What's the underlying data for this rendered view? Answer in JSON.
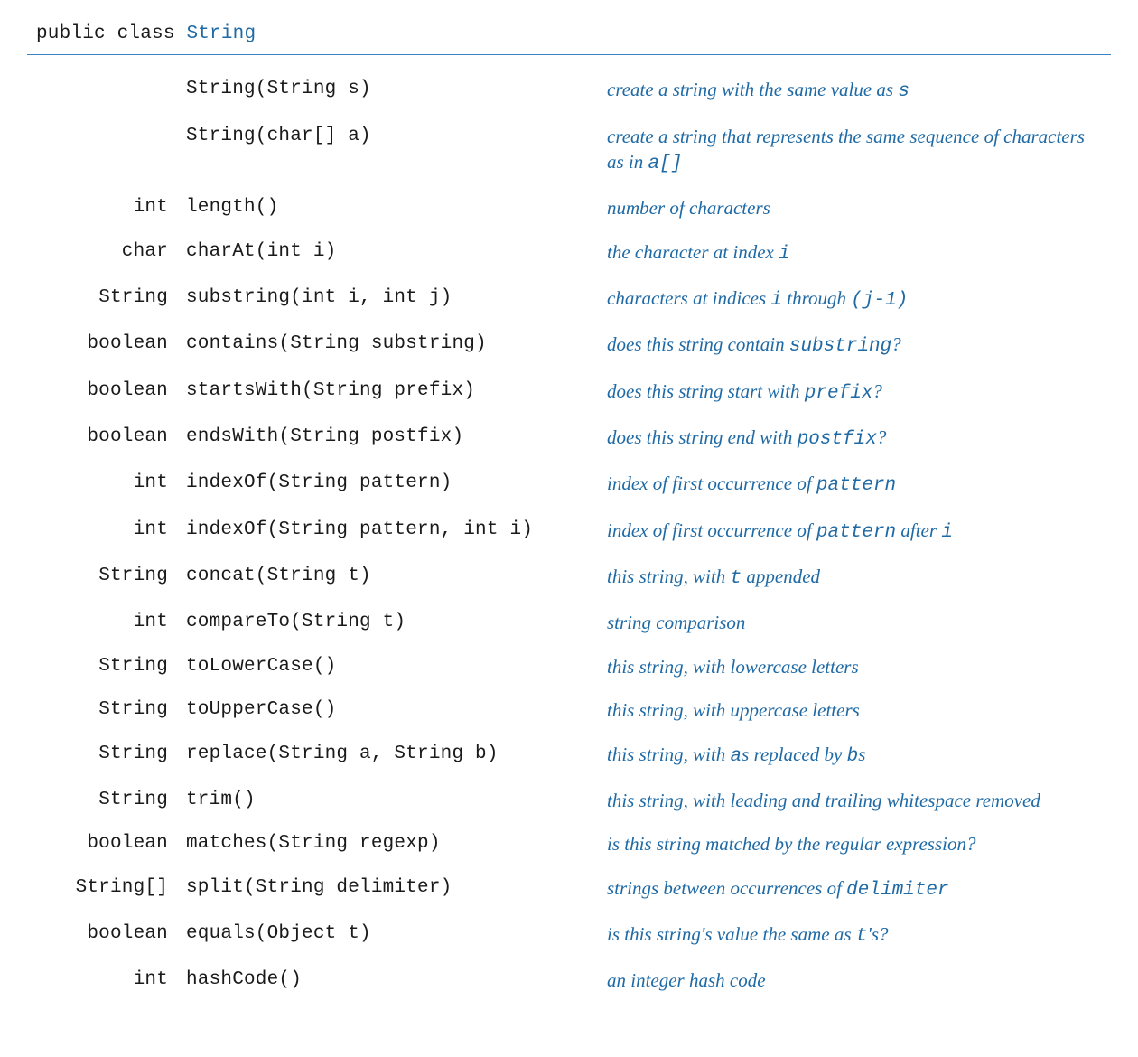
{
  "header": {
    "prefix": "public class ",
    "class_name": "String"
  },
  "rows": [
    {
      "return_type": "",
      "signature": "String(String s)",
      "desc_parts": [
        {
          "t": "text",
          "v": "create a string with the same value as "
        },
        {
          "t": "code",
          "v": "s"
        }
      ]
    },
    {
      "return_type": "",
      "signature": "String(char[] a)",
      "desc_parts": [
        {
          "t": "text",
          "v": "create a string that represents the same sequence of characters as in "
        },
        {
          "t": "code",
          "v": "a[]"
        }
      ]
    },
    {
      "return_type": "int",
      "signature": "length()",
      "desc_parts": [
        {
          "t": "text",
          "v": "number of characters"
        }
      ]
    },
    {
      "return_type": "char",
      "signature": "charAt(int i)",
      "desc_parts": [
        {
          "t": "text",
          "v": "the character at index "
        },
        {
          "t": "code",
          "v": "i"
        }
      ]
    },
    {
      "return_type": "String",
      "signature": "substring(int i, int j)",
      "desc_parts": [
        {
          "t": "text",
          "v": "characters at indices "
        },
        {
          "t": "code",
          "v": "i"
        },
        {
          "t": "text",
          "v": " through "
        },
        {
          "t": "code",
          "v": "(j-1)"
        }
      ]
    },
    {
      "return_type": "boolean",
      "signature": "contains(String substring)",
      "desc_parts": [
        {
          "t": "text",
          "v": "does this string contain "
        },
        {
          "t": "code",
          "v": "substring"
        },
        {
          "t": "text",
          "v": "?"
        }
      ]
    },
    {
      "return_type": "boolean",
      "signature": "startsWith(String prefix)",
      "desc_parts": [
        {
          "t": "text",
          "v": "does this string start with "
        },
        {
          "t": "code",
          "v": "prefix"
        },
        {
          "t": "text",
          "v": "?"
        }
      ]
    },
    {
      "return_type": "boolean",
      "signature": "endsWith(String postfix)",
      "desc_parts": [
        {
          "t": "text",
          "v": "does this string end with "
        },
        {
          "t": "code",
          "v": "postfix"
        },
        {
          "t": "text",
          "v": "?"
        }
      ]
    },
    {
      "return_type": "int",
      "signature": "indexOf(String pattern)",
      "desc_parts": [
        {
          "t": "text",
          "v": "index of first occurrence of "
        },
        {
          "t": "code",
          "v": "pattern"
        }
      ]
    },
    {
      "return_type": "int",
      "signature": "indexOf(String pattern, int i)",
      "desc_parts": [
        {
          "t": "text",
          "v": "index of first occurrence of "
        },
        {
          "t": "code",
          "v": "pattern"
        },
        {
          "t": "text",
          "v": " after "
        },
        {
          "t": "code",
          "v": "i"
        }
      ]
    },
    {
      "return_type": "String",
      "signature": "concat(String t)",
      "desc_parts": [
        {
          "t": "text",
          "v": "this string, with "
        },
        {
          "t": "code",
          "v": "t"
        },
        {
          "t": "text",
          "v": " appended"
        }
      ]
    },
    {
      "return_type": "int",
      "signature": "compareTo(String t)",
      "desc_parts": [
        {
          "t": "text",
          "v": "string comparison"
        }
      ]
    },
    {
      "return_type": "String",
      "signature": "toLowerCase()",
      "desc_parts": [
        {
          "t": "text",
          "v": "this string, with lowercase letters"
        }
      ]
    },
    {
      "return_type": "String",
      "signature": "toUpperCase()",
      "desc_parts": [
        {
          "t": "text",
          "v": "this string, with uppercase letters"
        }
      ]
    },
    {
      "return_type": "String",
      "signature": "replace(String a, String b)",
      "desc_parts": [
        {
          "t": "text",
          "v": "this string, with "
        },
        {
          "t": "code",
          "v": "a"
        },
        {
          "t": "text",
          "v": "s replaced by "
        },
        {
          "t": "code",
          "v": "b"
        },
        {
          "t": "text",
          "v": "s"
        }
      ]
    },
    {
      "return_type": "String",
      "signature": "trim()",
      "desc_parts": [
        {
          "t": "text",
          "v": "this string, with leading and trailing whitespace removed"
        }
      ]
    },
    {
      "return_type": "boolean",
      "signature": "matches(String regexp)",
      "desc_parts": [
        {
          "t": "text",
          "v": "is this string matched by the regular expression?"
        }
      ]
    },
    {
      "return_type": "String[]",
      "signature": "split(String delimiter)",
      "desc_parts": [
        {
          "t": "text",
          "v": "strings between occurrences of "
        },
        {
          "t": "code",
          "v": "delimiter"
        }
      ]
    },
    {
      "return_type": "boolean",
      "signature": "equals(Object t)",
      "desc_parts": [
        {
          "t": "text",
          "v": "is this string's value the same as "
        },
        {
          "t": "code",
          "v": "t"
        },
        {
          "t": "text",
          "v": "'s?"
        }
      ]
    },
    {
      "return_type": "int",
      "signature": "hashCode()",
      "desc_parts": [
        {
          "t": "text",
          "v": "an integer hash code"
        }
      ]
    }
  ]
}
